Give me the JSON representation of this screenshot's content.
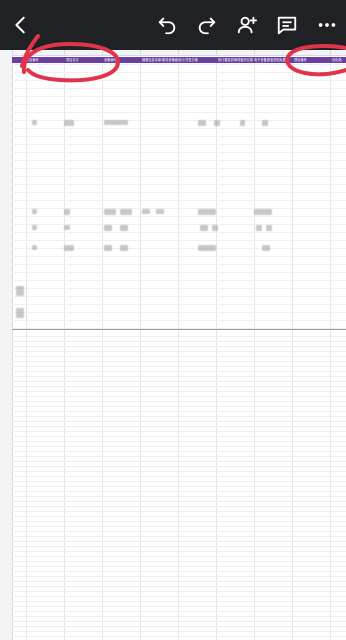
{
  "toolbar": {
    "icons": [
      "back-arrow-icon",
      "undo-icon",
      "redo-icon",
      "add-person-icon",
      "comment-icon",
      "more-icon"
    ],
    "background": "#202124",
    "icon_color": "#ffffff"
  },
  "sheet": {
    "header_color": "#6a3fa0",
    "header_labels": [
      "项目编号",
      "项目名字",
      "设备编号",
      "摘要信息清单/服务准确度设计/开发方案",
      "执行要素的审核组织位置",
      "电子设备基准说明及要素",
      "项目编号",
      "优化指"
    ],
    "annotation_color": "#e0344a"
  }
}
